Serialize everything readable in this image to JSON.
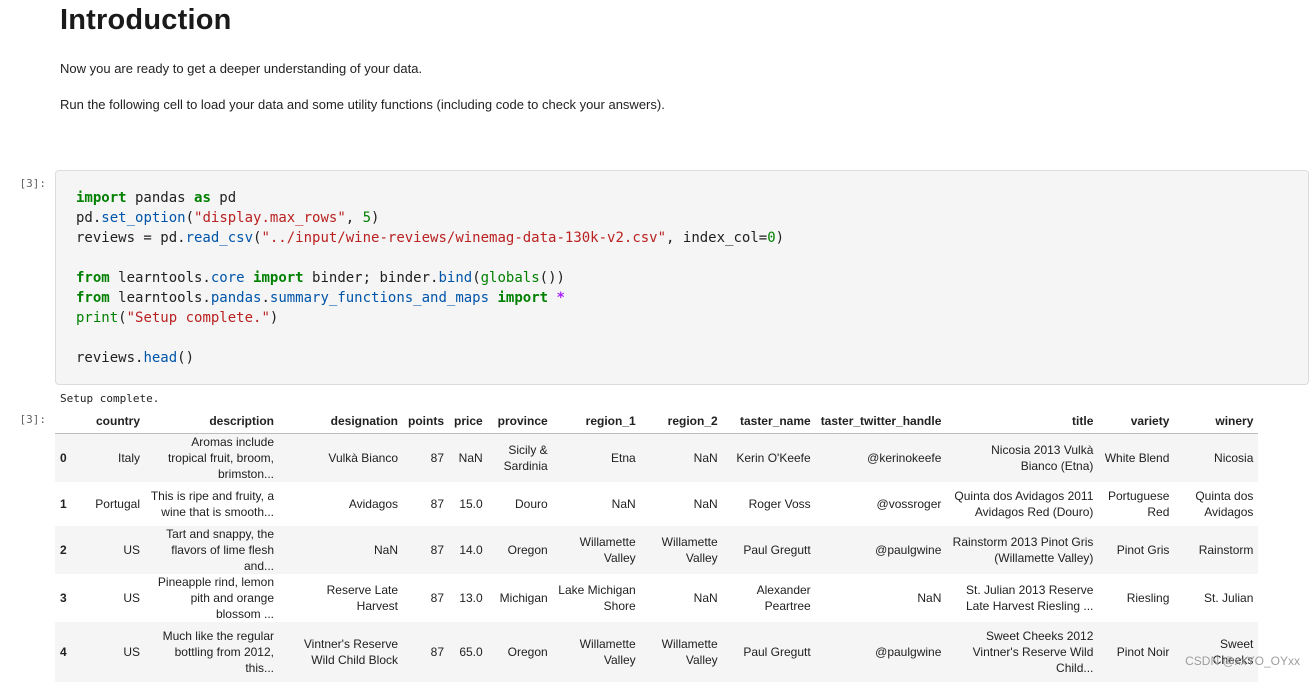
{
  "markdown": {
    "title": "Introduction",
    "para1": "Now you are ready to get a deeper understanding of your data.",
    "para2": "Run the following cell to load your data and some utility functions (including code to check your answers)."
  },
  "cell": {
    "input_prompt": "[3]:",
    "output_prompt": "[3]:",
    "code_lines": [
      "import pandas as pd",
      "pd.set_option(\"display.max_rows\", 5)",
      "reviews = pd.read_csv(\"../input/wine-reviews/winemag-data-130k-v2.csv\", index_col=0)",
      "",
      "from learntools.core import binder; binder.bind(globals())",
      "from learntools.pandas.summary_functions_and_maps import *",
      "print(\"Setup complete.\")",
      "",
      "reviews.head()"
    ],
    "stdout": "Setup complete."
  },
  "dataframe": {
    "columns": [
      "",
      "country",
      "description",
      "designation",
      "points",
      "price",
      "province",
      "region_1",
      "region_2",
      "taster_name",
      "taster_twitter_handle",
      "title",
      "variety",
      "winery"
    ],
    "rows": [
      [
        "0",
        "Italy",
        "Aromas include tropical fruit, broom, brimston...",
        "Vulkà Bianco",
        "87",
        "NaN",
        "Sicily & Sardinia",
        "Etna",
        "NaN",
        "Kerin O'Keefe",
        "@kerinokeefe",
        "Nicosia 2013 Vulkà Bianco (Etna)",
        "White Blend",
        "Nicosia"
      ],
      [
        "1",
        "Portugal",
        "This is ripe and fruity, a wine that is smooth...",
        "Avidagos",
        "87",
        "15.0",
        "Douro",
        "NaN",
        "NaN",
        "Roger Voss",
        "@vossroger",
        "Quinta dos Avidagos 2011 Avidagos Red (Douro)",
        "Portuguese Red",
        "Quinta dos Avidagos"
      ],
      [
        "2",
        "US",
        "Tart and snappy, the flavors of lime flesh and...",
        "NaN",
        "87",
        "14.0",
        "Oregon",
        "Willamette Valley",
        "Willamette Valley",
        "Paul Gregutt",
        "@paulgwine",
        "Rainstorm 2013 Pinot Gris (Willamette Valley)",
        "Pinot Gris",
        "Rainstorm"
      ],
      [
        "3",
        "US",
        "Pineapple rind, lemon pith and orange blossom ...",
        "Reserve Late Harvest",
        "87",
        "13.0",
        "Michigan",
        "Lake Michigan Shore",
        "NaN",
        "Alexander Peartree",
        "NaN",
        "St. Julian 2013 Reserve Late Harvest Riesling ...",
        "Riesling",
        "St. Julian"
      ],
      [
        "4",
        "US",
        "Much like the regular bottling from 2012, this...",
        "Vintner's Reserve Wild Child Block",
        "87",
        "65.0",
        "Oregon",
        "Willamette Valley",
        "Willamette Valley",
        "Paul Gregutt",
        "@paulgwine",
        "Sweet Cheeks 2012 Vintner's Reserve Wild Child...",
        "Pinot Noir",
        "Sweet Cheeks"
      ]
    ]
  },
  "watermark": "CSDN @xxYO_OYxx"
}
